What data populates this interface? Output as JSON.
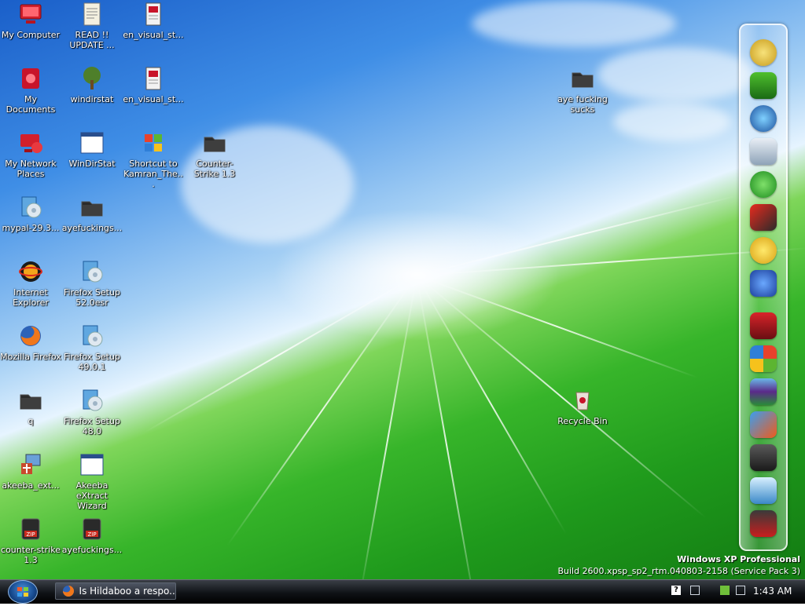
{
  "desktop_icons": [
    {
      "label": "My Computer"
    },
    {
      "label": "My Documents"
    },
    {
      "label": "My Network Places"
    },
    {
      "label": "mypal-29.3..."
    },
    {
      "label": "Internet Explorer"
    },
    {
      "label": "Mozilla Firefox"
    },
    {
      "label": "q"
    },
    {
      "label": "akeeba_ext..."
    },
    {
      "label": "counter-strike 1.3"
    },
    {
      "label": "READ !! UPDATE ..."
    },
    {
      "label": "windirstat"
    },
    {
      "label": "WinDirStat"
    },
    {
      "label": "ayefuckings..."
    },
    {
      "label": "Firefox Setup 52.0esr"
    },
    {
      "label": "Firefox Setup 49.0.1"
    },
    {
      "label": "Firefox Setup 48.0"
    },
    {
      "label": "Akeeba eXtract Wizard"
    },
    {
      "label": "ayefuckings..."
    },
    {
      "label": "en_visual_st..."
    },
    {
      "label": "en_visual_st..."
    },
    {
      "label": "Shortcut to Kamran_The..."
    },
    {
      "label": "Counter-Strike 1.3"
    },
    {
      "label": "aye fucking sucks"
    },
    {
      "label": "Recycle Bin"
    }
  ],
  "watermark": {
    "title": "Windows XP Professional",
    "build": "Build 2600.xpsp_sp2_rtm.040803-2158 (Service Pack 3)"
  },
  "dock": {
    "items": [
      {
        "icon": "orb-icon"
      },
      {
        "icon": "monitor-icon"
      },
      {
        "icon": "globe-icon"
      },
      {
        "icon": "media-player-icon"
      },
      {
        "icon": "internet-explorer-icon"
      },
      {
        "icon": "film-icon"
      },
      {
        "icon": "smiley-icon"
      },
      {
        "icon": "messenger-icon"
      },
      {
        "icon": "red-box-icon"
      },
      {
        "icon": "windows-flag-icon"
      },
      {
        "icon": "winrar-icon"
      },
      {
        "icon": "butterfly-icon"
      },
      {
        "icon": "printer-icon"
      },
      {
        "icon": "tool-icon"
      },
      {
        "icon": "robot-icon"
      }
    ]
  },
  "taskbar": {
    "window_button": "Is Hildaboo a respo...",
    "clock": "1:43 AM"
  }
}
